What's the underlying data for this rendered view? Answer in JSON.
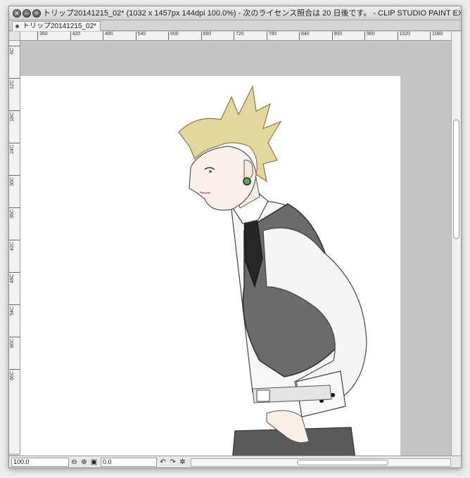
{
  "window": {
    "title": "トリップ20141215_02* (1032 x 1457px 144dpi 100.0%)  - 次のライセンス照合は 20 日後です。 - CLIP STUDIO PAINT EX",
    "buttons": {
      "close": "✕",
      "minimize": "–",
      "maximize": "+"
    }
  },
  "tab": {
    "label": "トリップ20141215_02*"
  },
  "rulers": {
    "horizontal": [
      "360",
      "420",
      "480",
      "540",
      "600",
      "660",
      "720",
      "780",
      "840",
      "900",
      "960",
      "1020",
      "1080"
    ],
    "vertical": [
      "6C",
      "12C",
      "18C",
      "24C",
      "30C",
      "36C",
      "42C",
      "48C",
      "54C",
      "60C",
      "66C"
    ]
  },
  "statusbar": {
    "zoom": "100.0",
    "rotation": "0.0",
    "icons": [
      "zoom-out-icon",
      "zoom-in-icon",
      "fit-icon",
      "rotate-left-icon",
      "rotate-right-icon",
      "reset-icon"
    ]
  },
  "colors": {
    "vest": "#6b6b6b",
    "hair": "#e4d79c",
    "tie": "#2a2a2a",
    "earring": "#4caf50",
    "canvas_bg": "#c5c5c5"
  }
}
